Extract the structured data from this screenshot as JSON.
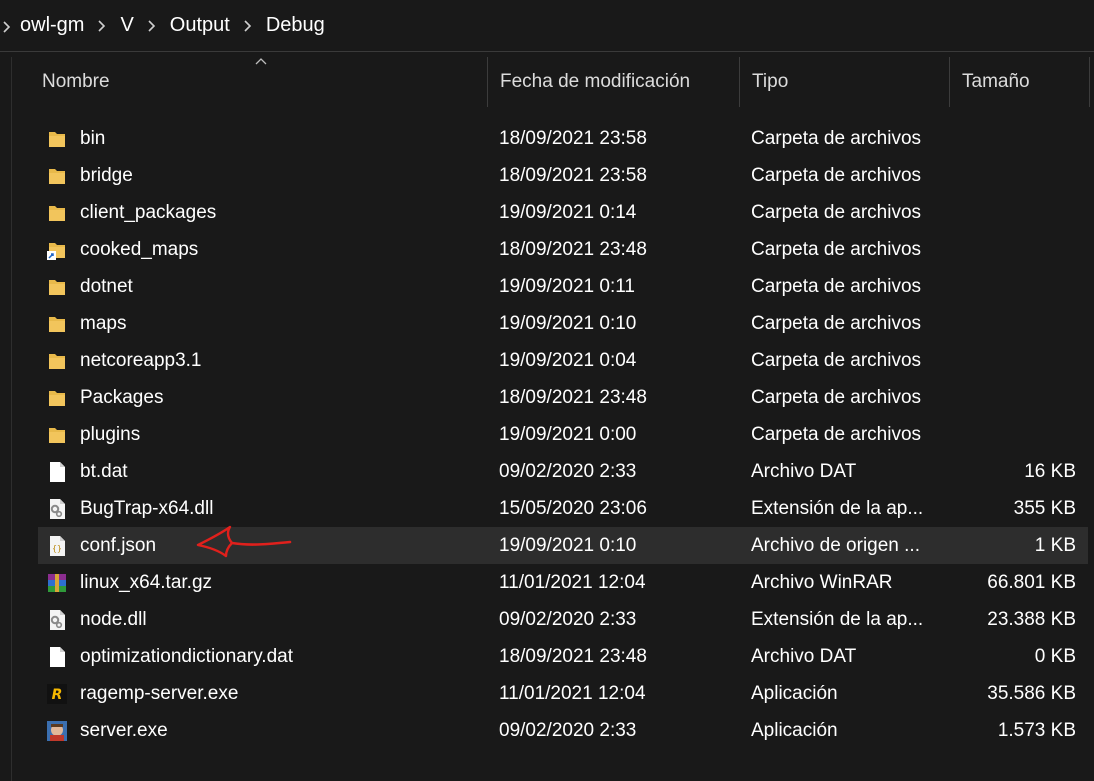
{
  "breadcrumb": {
    "items": [
      "owl-gm",
      "V",
      "Output",
      "Debug"
    ]
  },
  "columns": {
    "name": "Nombre",
    "date": "Fecha de modificación",
    "type": "Tipo",
    "size": "Tamaño"
  },
  "rows": [
    {
      "name": "bin",
      "date": "18/09/2021 23:58",
      "type": "Carpeta de archivos",
      "size": "",
      "icon": "folder-icon"
    },
    {
      "name": "bridge",
      "date": "18/09/2021 23:58",
      "type": "Carpeta de archivos",
      "size": "",
      "icon": "folder-icon"
    },
    {
      "name": "client_packages",
      "date": "19/09/2021 0:14",
      "type": "Carpeta de archivos",
      "size": "",
      "icon": "folder-icon"
    },
    {
      "name": "cooked_maps",
      "date": "18/09/2021 23:48",
      "type": "Carpeta de archivos",
      "size": "",
      "icon": "folder-shortcut-icon"
    },
    {
      "name": "dotnet",
      "date": "19/09/2021 0:11",
      "type": "Carpeta de archivos",
      "size": "",
      "icon": "folder-icon"
    },
    {
      "name": "maps",
      "date": "19/09/2021 0:10",
      "type": "Carpeta de archivos",
      "size": "",
      "icon": "folder-icon"
    },
    {
      "name": "netcoreapp3.1",
      "date": "19/09/2021 0:04",
      "type": "Carpeta de archivos",
      "size": "",
      "icon": "folder-icon"
    },
    {
      "name": "Packages",
      "date": "18/09/2021 23:48",
      "type": "Carpeta de archivos",
      "size": "",
      "icon": "folder-icon"
    },
    {
      "name": "plugins",
      "date": "19/09/2021 0:00",
      "type": "Carpeta de archivos",
      "size": "",
      "icon": "folder-icon"
    },
    {
      "name": "bt.dat",
      "date": "09/02/2020 2:33",
      "type": "Archivo DAT",
      "size": "16 KB",
      "icon": "file-icon"
    },
    {
      "name": "BugTrap-x64.dll",
      "date": "15/05/2020 23:06",
      "type": "Extensión de la ap...",
      "size": "355 KB",
      "icon": "dll-gear-icon"
    },
    {
      "name": "conf.json",
      "date": "19/09/2021 0:10",
      "type": "Archivo de origen ...",
      "size": "1 KB",
      "icon": "json-file-icon"
    },
    {
      "name": "linux_x64.tar.gz",
      "date": "11/01/2021 12:04",
      "type": "Archivo WinRAR",
      "size": "66.801 KB",
      "icon": "winrar-icon"
    },
    {
      "name": "node.dll",
      "date": "09/02/2020 2:33",
      "type": "Extensión de la ap...",
      "size": "23.388 KB",
      "icon": "dll-gear-icon"
    },
    {
      "name": "optimizationdictionary.dat",
      "date": "18/09/2021 23:48",
      "type": "Archivo DAT",
      "size": "0 KB",
      "icon": "file-icon"
    },
    {
      "name": "ragemp-server.exe",
      "date": "11/01/2021 12:04",
      "type": "Aplicación",
      "size": "35.586 KB",
      "icon": "ragemp-icon"
    },
    {
      "name": "server.exe",
      "date": "09/02/2020 2:33",
      "type": "Aplicación",
      "size": "1.573 KB",
      "icon": "server-exe-icon"
    }
  ],
  "selected_row": 11,
  "colors": {
    "background": "#191919",
    "selected_row": "#2d2d2d",
    "folder": "#f2c55c",
    "annotation": "#e0201c"
  }
}
